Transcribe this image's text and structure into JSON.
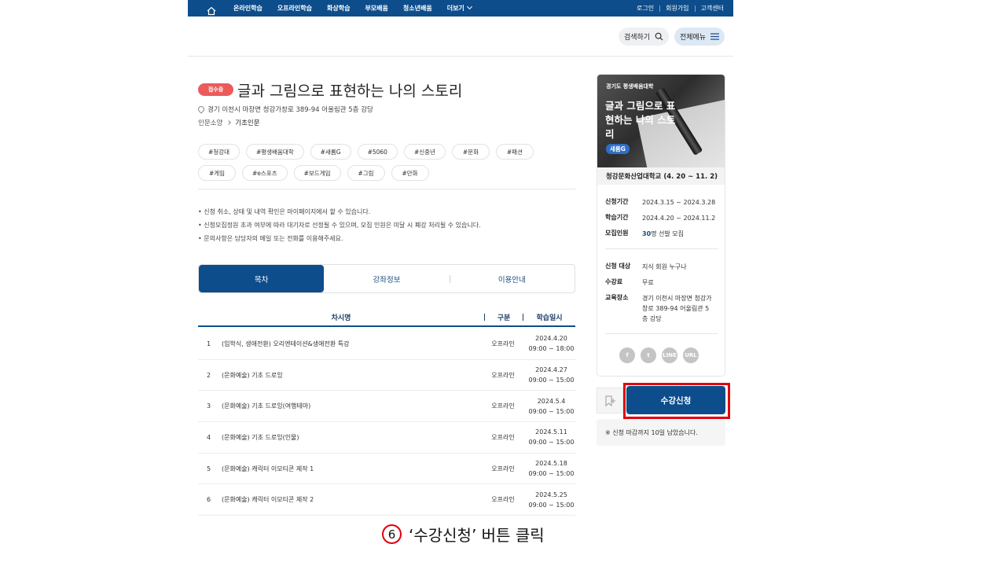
{
  "topnav": {
    "menu": [
      "온라인학습",
      "오프라인학습",
      "화상학습",
      "부모배움",
      "청소년배움",
      "더보기"
    ],
    "right": [
      "로그인",
      "회원가입",
      "고객센터"
    ]
  },
  "header": {
    "search_label": "검색하기",
    "allmenu_label": "전체메뉴"
  },
  "course": {
    "status_badge": "접수중",
    "title": "글과 그림으로 표현하는 나의 스토리",
    "location": "경기 이천시 마장면 청강가창로 389-94 어울림관 5층 강당",
    "category": "인문소양",
    "subcategory": "기초인문",
    "tags": [
      "#청강대",
      "#평생배움대학",
      "#새롬G",
      "#5060",
      "#신중년",
      "#문화",
      "#패션",
      "#게임",
      "#e스포츠",
      "#보드게임",
      "#그림",
      "#만화"
    ],
    "notes": [
      "• 신청 취소, 상태 및 내역 확인은 마이페이지에서 할 수 있습니다.",
      "• 신청모집정원 초과 여부에 따라 대기자로 선정될 수 있으며, 모집 인원은 미달 시 폐강 처리될 수 있습니다.",
      "• 문의사항은 담당자의 메일 또는 전화를 이용해주세요."
    ]
  },
  "tabs": [
    "목차",
    "강좌정보",
    "이용안내"
  ],
  "table": {
    "headers": [
      "차시명",
      "구분",
      "학습일시"
    ],
    "rows": [
      {
        "no": "1",
        "name": "(입학식, 생애전환) 오리엔테이션&생애전환 특강",
        "type": "오프라인",
        "date": "2024.4.20",
        "time": "09:00 ~ 18:00"
      },
      {
        "no": "2",
        "name": "(문화예술) 기초 드로잉",
        "type": "오프라인",
        "date": "2024.4.27",
        "time": "09:00 ~ 15:00"
      },
      {
        "no": "3",
        "name": "(문화예술) 기초 드로잉(여행테마)",
        "type": "오프라인",
        "date": "2024.5.4",
        "time": "09:00 ~ 15:00"
      },
      {
        "no": "4",
        "name": "(문화예술) 기초 드로잉(인물)",
        "type": "오프라인",
        "date": "2024.5.11",
        "time": "09:00 ~ 15:00"
      },
      {
        "no": "5",
        "name": "(문화예술) 캐릭터 이모티콘 제작 1",
        "type": "오프라인",
        "date": "2024.5.18",
        "time": "09:00 ~ 15:00"
      },
      {
        "no": "6",
        "name": "(문화예술) 캐릭터 이모티콘 제작 2",
        "type": "오프라인",
        "date": "2024.5.25",
        "time": "09:00 ~ 15:00"
      }
    ]
  },
  "sidebar": {
    "thumb_org": "경기도 평생배움대학",
    "thumb_title": "글과 그림으로 표현하는 나의 스토리",
    "thumb_brand": "새롬G",
    "school": "청강문화산업대학교 (4. 20 ~ 11. 2)",
    "period_label": "신청기간",
    "period_value": "2024.3.15 ~ 2024.3.28",
    "study_label": "학습기간",
    "study_value": "2024.4.20 ~ 2024.11.2",
    "recruit_label": "모집인원",
    "recruit_count": "30",
    "recruit_suffix": "명 선발 모집",
    "target_label": "신청 대상",
    "target_value": "지식 회원 누구나",
    "fee_label": "수강료",
    "fee_value": "무료",
    "place_label": "교육장소",
    "place_value": "경기 이천시 마장면 청강가창로 389-94 어울림관 5층 강당",
    "sns": [
      "f",
      "t",
      "LINE",
      "URL"
    ],
    "apply_label": "수강신청",
    "deadline": "※ 신청 마감까지 10일 남았습니다."
  },
  "caption": {
    "step": "6",
    "text": "‘수강신청’ 버튼 클릭"
  },
  "colors": {
    "primary": "#0d4d8b",
    "badge": "#ec5b5b",
    "highlight": "#e1000e"
  }
}
